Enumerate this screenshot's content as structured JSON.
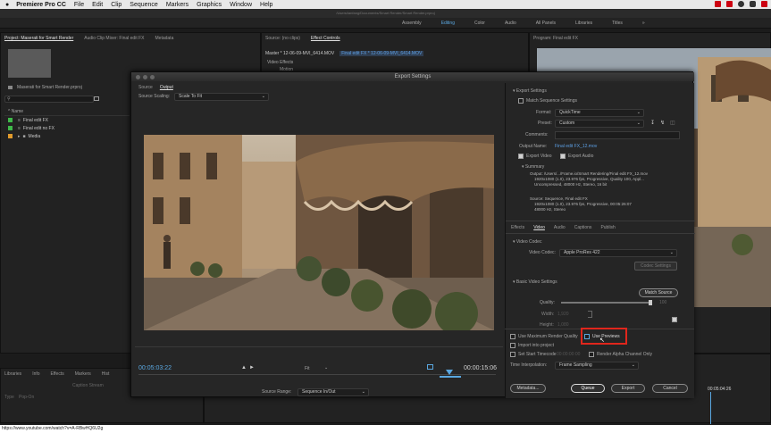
{
  "menubar": {
    "app": "Premiere Pro CC",
    "items": [
      "File",
      "Edit",
      "Clip",
      "Sequence",
      "Markers",
      "Graphics",
      "Window",
      "Help"
    ]
  },
  "app_header": {
    "path": "/Users/lanfang/Documents/Smart Render/Smart Render.prproj"
  },
  "workspaces": [
    "Assembly",
    "Editing",
    "Color",
    "Audio",
    "All Panels",
    "Libraries",
    "Titles"
  ],
  "workspace_active": "Editing",
  "project_panel": {
    "tabs": [
      "Project: Maserati for Smart Render",
      "Audio Clip Mixer: Final edit FX",
      "Metadata"
    ],
    "bin_label": "Maserati for Smart Render.prproj",
    "name_header": "Name",
    "items": [
      {
        "name": "Final edit FX",
        "color": "#3fb84a"
      },
      {
        "name": "Final edit no FX",
        "color": "#3fb84a"
      },
      {
        "name": "Media",
        "color": "#e09a2c"
      }
    ]
  },
  "source_panel": {
    "tabs": [
      "Source: (no clips)",
      "Effect Controls"
    ],
    "master_line": "Master * 12-06-09-MVI_6414.MOV",
    "sequence_line": "Final edit FX * 12-06-09-MVI_6414.MOV",
    "video_effects": "Video Effects",
    "motion": "Motion"
  },
  "program_panel": {
    "tab": "Program: Final edit FX"
  },
  "bottom_left": {
    "tabs": [
      "Libraries",
      "Info",
      "Effects",
      "Markers",
      "Hist"
    ],
    "caption_stream": "Caption Stream",
    "type_label": "Type",
    "type_value": "Pop-On"
  },
  "timeline": {
    "timecode": "00:05:04:26"
  },
  "export_dialog": {
    "title": "Export Settings",
    "tabs": [
      "Source",
      "Output"
    ],
    "source_scaling_label": "Source Scaling:",
    "source_scaling_value": "Scale To Fit",
    "current_time": "00:05:03:22",
    "duration": "00:00:15:06",
    "fit_label": "Fit",
    "source_range_label": "Source Range:",
    "source_range_value": "Sequence In/Out",
    "export_settings_header": "Export Settings",
    "match_sequence": "Match Sequence Settings",
    "format_label": "Format:",
    "format_value": "QuickTime",
    "preset_label": "Preset:",
    "preset_value": "Custom",
    "comments_label": "Comments:",
    "output_name_label": "Output Name:",
    "output_name_value": "Final edit FX_12.mov",
    "export_video": "Export Video",
    "export_audio": "Export Audio",
    "summary_header": "Summary",
    "summary_output": "Output: /Users/.../Frame.io/Smart Rendering/Final edit FX_12.mov\n    1920x1080 (1.0), 23.976 fps, Progressive, Quality 100, Appl...\n    Uncompressed, 48000 Hz, Stereo, 16 bit",
    "summary_source": "Source: Sequence, Final edit FX\n    1920x1080 (1.0), 23.976 fps, Progressive, 00:05:26:07\n    48000 Hz, Stereo",
    "settings_tabs": [
      "Effects",
      "Video",
      "Audio",
      "Captions",
      "Publish"
    ],
    "settings_tab_active": "Video",
    "video_codec_header": "Video Codec",
    "video_codec_label": "Video Codec:",
    "video_codec_value": "Apple ProRes 422",
    "codec_settings": "Codec Settings",
    "basic_video_header": "Basic Video Settings",
    "match_source": "Match Source",
    "quality_label": "Quality:",
    "quality_value": "100",
    "width_label": "Width:",
    "width_value": "1,920",
    "height_label": "Height:",
    "height_value": "1,080",
    "max_render_quality": "Use Maximum Render Quality",
    "use_previews": "Use Previews",
    "import_into_project": "Import into project",
    "set_start_timecode": "Set Start Timecode",
    "start_timecode_value": "00:00:00:00",
    "render_alpha": "Render Alpha Channel Only",
    "time_interp_label": "Time Interpolation:",
    "time_interp_value": "Frame Sampling",
    "metadata_btn": "Metadata...",
    "queue_btn": "Queue",
    "export_btn": "Export",
    "cancel_btn": "Cancel"
  },
  "url_overlay": "https://www.youtube.com/watch?v=A-RBwHQ6U2g",
  "colors": {
    "accent_blue": "#5aa7e0",
    "highlight_red": "#e0261c",
    "green_label": "#3fb84a",
    "orange_label": "#e09a2c"
  }
}
